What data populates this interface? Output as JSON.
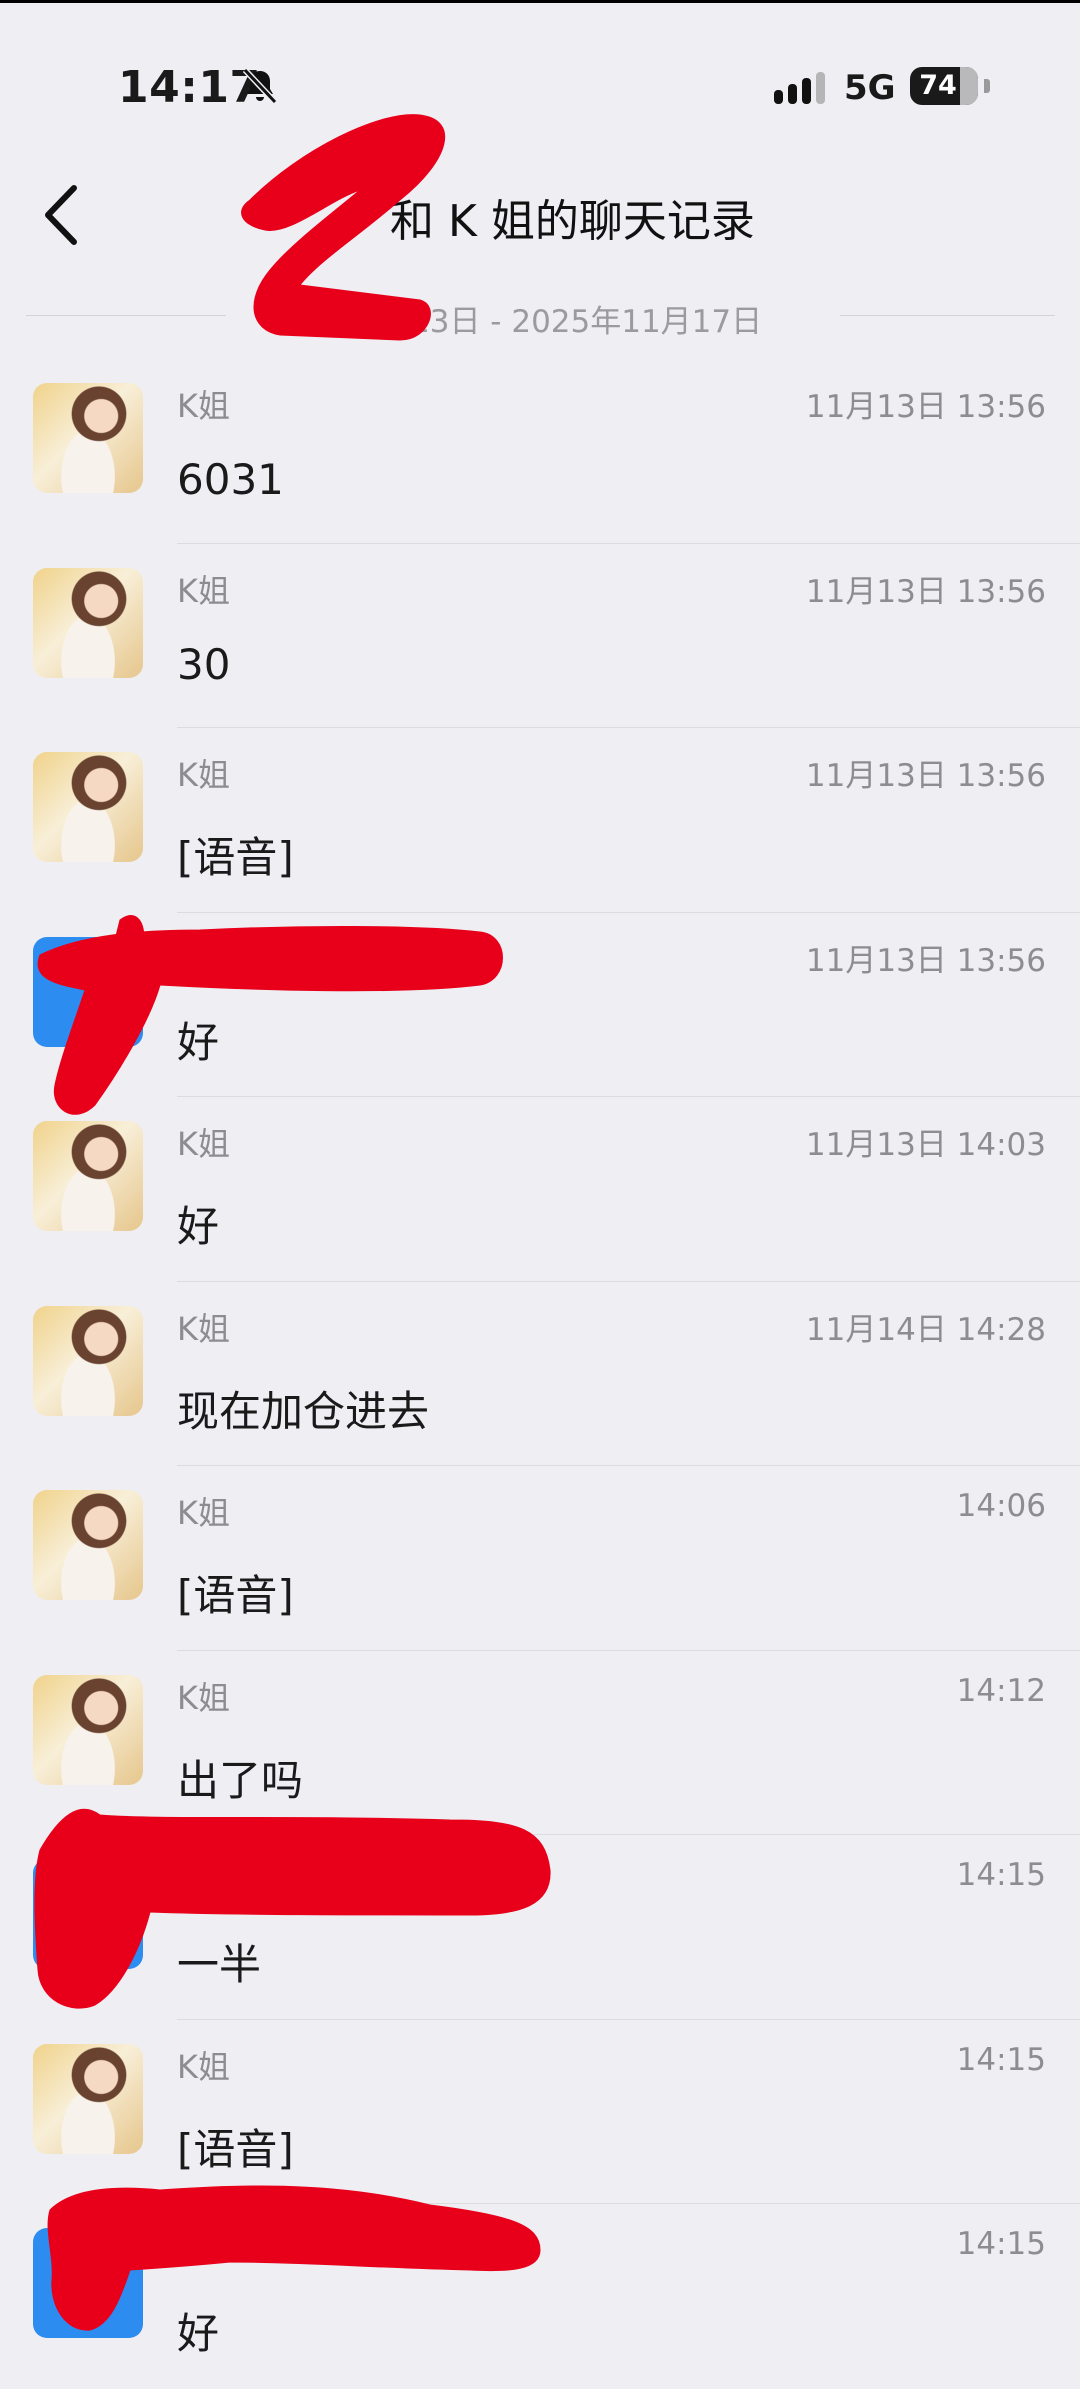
{
  "status": {
    "time": "14:17",
    "network": "5G",
    "battery": "74",
    "battery_level": 0.74
  },
  "header": {
    "title": "和 K 姐的聊天记录",
    "date_range": "13日 - 2025年11月17日"
  },
  "messages": [
    {
      "sender": "K姐",
      "time": "11月13日 13:56",
      "text": "6031",
      "avatar": "photo"
    },
    {
      "sender": "K姐",
      "time": "11月13日 13:56",
      "text": "30",
      "avatar": "photo"
    },
    {
      "sender": "K姐",
      "time": "11月13日 13:56",
      "text": "[语音]",
      "avatar": "photo"
    },
    {
      "sender": "",
      "time": "11月13日 13:56",
      "text": "好",
      "avatar": "blue"
    },
    {
      "sender": "K姐",
      "time": "11月13日 14:03",
      "text": "好",
      "avatar": "photo"
    },
    {
      "sender": "K姐",
      "time": "11月14日 14:28",
      "text": "现在加仓进去",
      "avatar": "photo"
    },
    {
      "sender": "K姐",
      "time": "14:06",
      "text": "[语音]",
      "avatar": "photo"
    },
    {
      "sender": "K姐",
      "time": "14:12",
      "text": "出了吗",
      "avatar": "photo"
    },
    {
      "sender": "",
      "time": "14:15",
      "text": "一半",
      "avatar": "blue"
    },
    {
      "sender": "K姐",
      "time": "14:15",
      "text": "[语音]",
      "avatar": "photo"
    },
    {
      "sender": "",
      "time": "14:15",
      "text": "好",
      "avatar": "blue"
    }
  ],
  "icons": {
    "back": "chevron-left-icon",
    "bell": "bell-muted-icon",
    "signal": "signal-icon"
  },
  "colors": {
    "background": "#eeeef3",
    "redaction": "#e8001b",
    "self_avatar": "#2d8cf0"
  }
}
